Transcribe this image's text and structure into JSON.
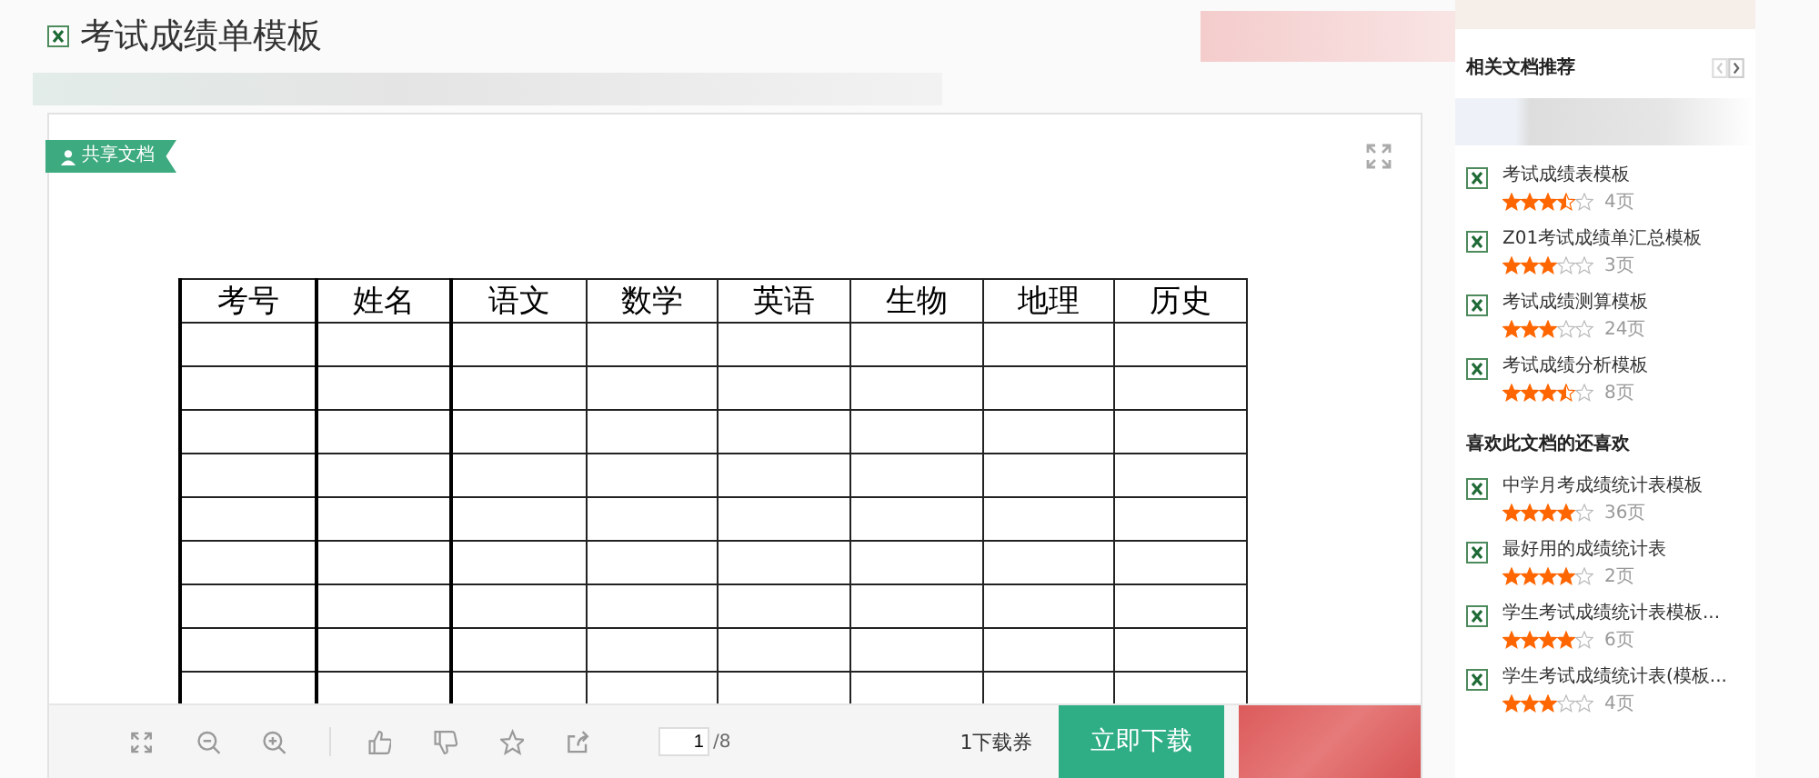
{
  "title": "考试成绩单模板",
  "document": {
    "badge": "共享文档",
    "table": {
      "columns": [
        "考号",
        "姓名",
        "语文",
        "数学",
        "英语",
        "生物",
        "地理",
        "历史"
      ]
    }
  },
  "toolbar": {
    "page_input": "1",
    "page_total": "/8",
    "coupon": "1下载券",
    "download": "立即下载"
  },
  "sidebar": {
    "related": {
      "title": "相关文档推荐",
      "items": [
        {
          "title": "考试成绩表模板",
          "stars": 3.5,
          "pages": "4页"
        },
        {
          "title": "Z01考试成绩单汇总模板",
          "stars": 3,
          "pages": "3页"
        },
        {
          "title": "考试成绩测算模板",
          "stars": 3,
          "pages": "24页"
        },
        {
          "title": "考试成绩分析模板",
          "stars": 3.5,
          "pages": "8页"
        }
      ]
    },
    "liked": {
      "title": "喜欢此文档的还喜欢",
      "items": [
        {
          "title": "中学月考成绩统计表模板",
          "stars": 4,
          "pages": "36页"
        },
        {
          "title": "最好用的成绩统计表",
          "stars": 4,
          "pages": "2页"
        },
        {
          "title": "学生考试成绩统计表模板...",
          "stars": 4,
          "pages": "6页"
        },
        {
          "title": "学生考试成绩统计表(模板...",
          "stars": 3,
          "pages": "4页"
        }
      ]
    }
  }
}
